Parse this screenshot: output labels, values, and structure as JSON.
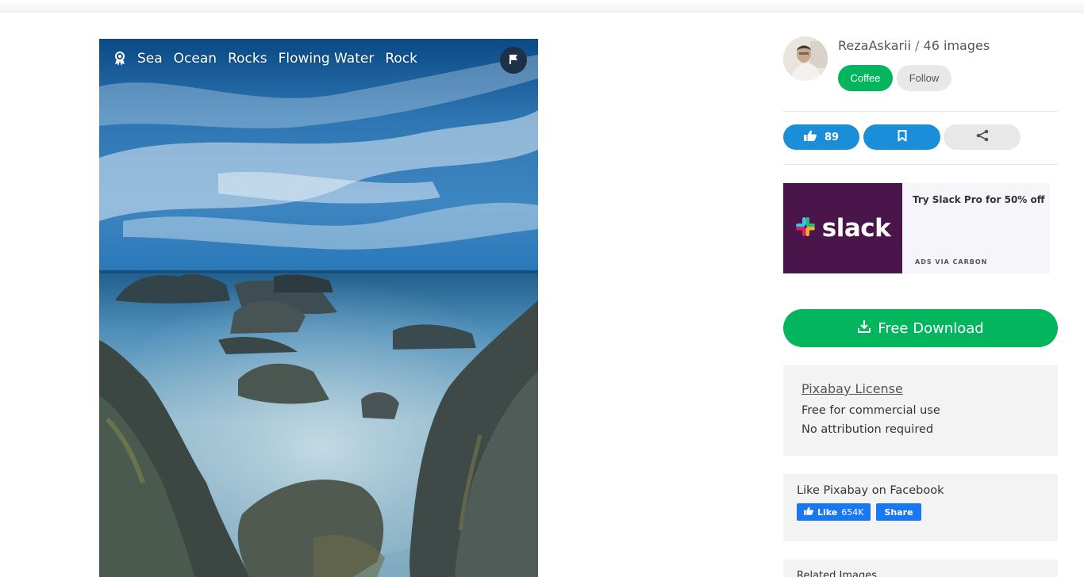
{
  "photo": {
    "tags": [
      "Sea",
      "Ocean",
      "Rocks",
      "Flowing Water",
      "Rock"
    ],
    "award_icon": "award-icon",
    "flag_icon": "flag-icon"
  },
  "user": {
    "name": "RezaAskarii",
    "separator": " / ",
    "images_count": "46 images",
    "coffee_label": "Coffee",
    "follow_label": "Follow"
  },
  "actions": {
    "like_count": "89",
    "like_icon": "thumbs-up-icon",
    "bookmark_icon": "bookmark-icon",
    "share_icon": "share-icon"
  },
  "ad": {
    "brand": "slack",
    "headline": "Try Slack Pro for 50% off",
    "via": "ADS VIA CARBON"
  },
  "download": {
    "label": "Free Download",
    "icon": "download-icon"
  },
  "license": {
    "title": "Pixabay License",
    "lines": [
      "Free for commercial use",
      "No attribution required"
    ]
  },
  "facebook": {
    "title": "Like Pixabay on Facebook",
    "like_label": "Like",
    "like_count": "654K",
    "share_label": "Share"
  },
  "related": {
    "title": "Related Images"
  },
  "colors": {
    "green": "#03b55d",
    "blue": "#1a8ed8",
    "slack_purple": "#4a154b",
    "facebook_blue": "#1877f2"
  }
}
